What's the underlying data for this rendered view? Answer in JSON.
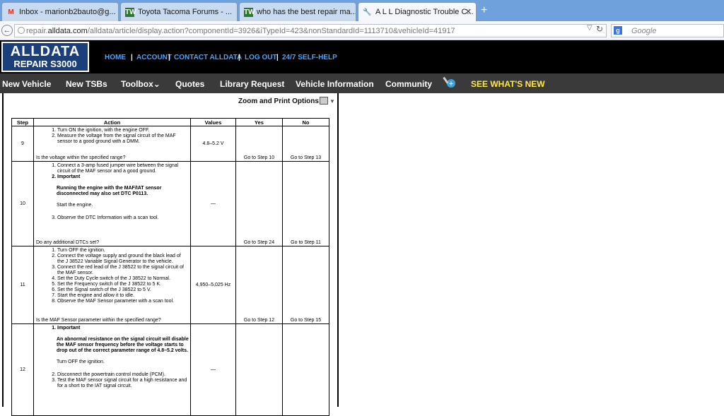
{
  "browser": {
    "tabs": [
      {
        "icon": "gmail-icon",
        "title": "Inbox - marionb2bauto@g...",
        "active": false
      },
      {
        "icon": "forum-icon",
        "title": "Toyota Tacoma Forums - ...",
        "active": false
      },
      {
        "icon": "forum-icon",
        "title": "who has the best repair ma...",
        "active": false
      },
      {
        "icon": "wrench-icon",
        "title": "A L L Diagnostic Trouble C...",
        "active": true
      }
    ],
    "new_tab": "+",
    "url_prefix": "repair.",
    "url_domain": "alldata.com",
    "url_rest": "/alldata/article/display.action?componentId=3926&iTypeId=423&nonStandardId=1113710&vehicleId=41917",
    "search_placeholder": "Google"
  },
  "site": {
    "logo_line1": "ALLDATA",
    "logo_line2": "REPAIR S3000",
    "top_links": [
      "HOME",
      "ACCOUNT",
      "CONTACT ALLDATA",
      "LOG OUT",
      "24/7 SELF-HELP"
    ],
    "nav": [
      "New Vehicle",
      "New TSBs",
      "Toolbox",
      "Quotes",
      "Library Request",
      "Vehicle Information",
      "Community",
      "SEE WHAT'S NEW"
    ],
    "toolbox_arrow": "⌄"
  },
  "content": {
    "zoom_label": "Zoom and Print Options",
    "headers": {
      "step": "Step",
      "action": "Action",
      "values": "Values",
      "yes": "Yes",
      "no": "No"
    },
    "rows": [
      {
        "step": "9",
        "actions": [
          "Turn ON the ignition, with the engine OFF.",
          "Measure the voltage from the signal circuit of the MAF sensor to a good ground with a DMM."
        ],
        "question": "Is the voltage within the specified range?",
        "value": "4.8–5.2 V",
        "yes": "Go to Step 10",
        "no": "Go to Step 13"
      },
      {
        "step": "10",
        "a1": "Connect a 3-amp fused jumper wire between the signal circuit of the MAF sensor and a good ground.",
        "a2": "Important",
        "a2_bold": "Running the engine with the MAF/IAT sensor disconnected may also set DTC P0113.",
        "a2_text": "Start the engine.",
        "a3": "Observe the DTC Information with a scan tool.",
        "question": "Do any additional DTCs set?",
        "value": "—",
        "yes": "Go to Step 24",
        "no": "Go to Step 11"
      },
      {
        "step": "11",
        "actions": [
          "Turn OFF the ignition.",
          "Connect the voltage supply and ground the black lead of the J 38522 Variable Signal Generator to the vehicle.",
          "Connect the red lead of the J 38522 to the signal circuit of the MAF sensor.",
          "Set the Duty Cycle switch of the J 38522 to Normal.",
          "Set the Frequency switch of the J 38522 to 5 K.",
          "Set the Signal switch of the J 38522 to 5 V.",
          "Start the engine and allow it to idle.",
          "Observe the MAF Sensor parameter with a scan tool."
        ],
        "question": "Is the MAF Sensor parameter within the specified range?",
        "value": "4,950–5,025 Hz",
        "yes": "Go to Step 12",
        "no": "Go to Step 15"
      },
      {
        "step": "12",
        "a1": "Important",
        "a1_bold": "An abnormal resistance on the signal circuit will disable the MAF sensor frequency before the voltage starts to drop out of the correct parameter range of 4.8–5.2 volts.",
        "a1_text": "Turn OFF the ignition.",
        "a2": "Disconnect the powertrain control module (PCM).",
        "a3": "Test the MAF sensor signal circuit for a high resistance and for a short to the IAT signal circuit.",
        "value": "—"
      }
    ]
  }
}
